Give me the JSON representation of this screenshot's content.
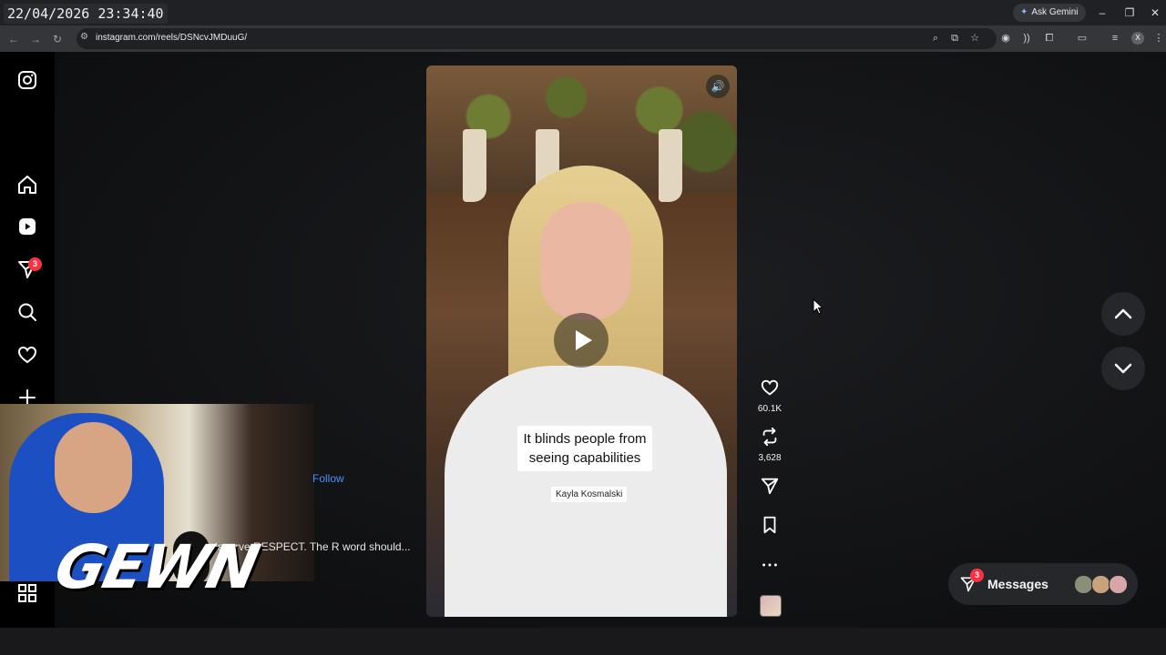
{
  "browser": {
    "timestamp": "22/04/2026 23:34:40",
    "gemini_label": "Ask Gemini",
    "url": "instagram.com/reels/DSNcvJMDuuG/",
    "profile_initial": "X"
  },
  "sidebar": {
    "items": [
      {
        "name": "instagram-logo-icon"
      },
      {
        "name": "home-icon"
      },
      {
        "name": "reels-icon"
      },
      {
        "name": "messages-icon",
        "badge": "3"
      },
      {
        "name": "search-icon"
      },
      {
        "name": "notifications-heart-icon"
      },
      {
        "name": "create-plus-icon"
      },
      {
        "name": "more-grid-icon"
      }
    ]
  },
  "reel": {
    "caption_lines": [
      "It blinds people from",
      "seeing capabilities"
    ],
    "credit": "Kayla Kosmalski",
    "likes": "60.1K",
    "reposts": "3,628",
    "follow_label": "Follow",
    "description": "deserve RESPECT. The R word should..."
  },
  "messages": {
    "label": "Messages",
    "badge": "3",
    "avatar_colors": [
      "#8a8f7a",
      "#c7a27a",
      "#d9a6a8"
    ]
  },
  "overlay": {
    "logo_text": "GEWN"
  },
  "colors": {
    "badge": "#ff3040",
    "follow": "#4a90ff",
    "panel": "#26272a"
  }
}
